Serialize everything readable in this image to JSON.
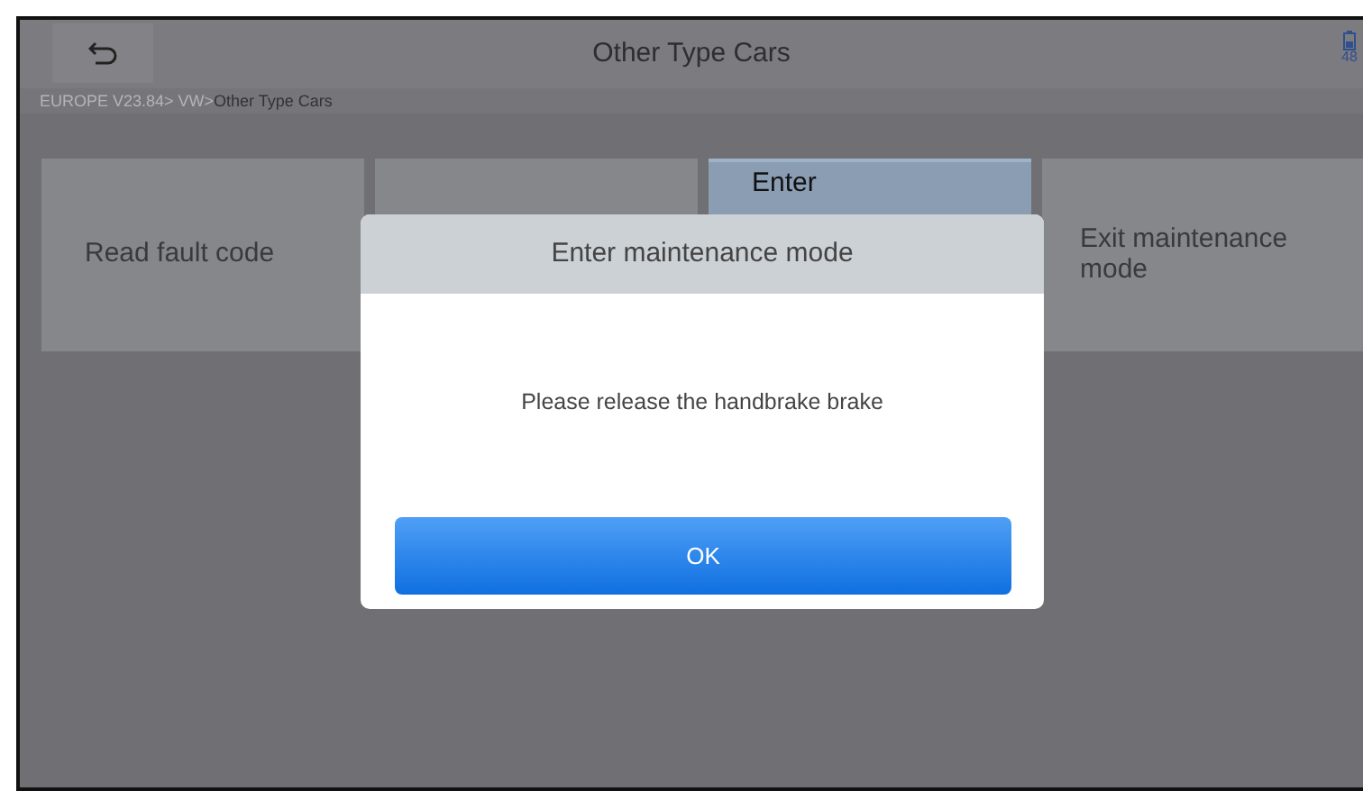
{
  "top_bar": {
    "title": "Other Type Cars",
    "battery": "48"
  },
  "breadcrumb": {
    "path": "EUROPE V23.84> VW>",
    "current": "Other Type Cars"
  },
  "tiles": [
    {
      "label": "Read fault code",
      "selected": false
    },
    {
      "selected": false
    },
    {
      "label": "Enter",
      "selected": true
    },
    {
      "label": "Exit maintenance mode",
      "selected": false
    }
  ],
  "dialog": {
    "title": "Enter maintenance mode",
    "message": "Please release the handbrake brake",
    "buttons": [
      "OK"
    ]
  }
}
